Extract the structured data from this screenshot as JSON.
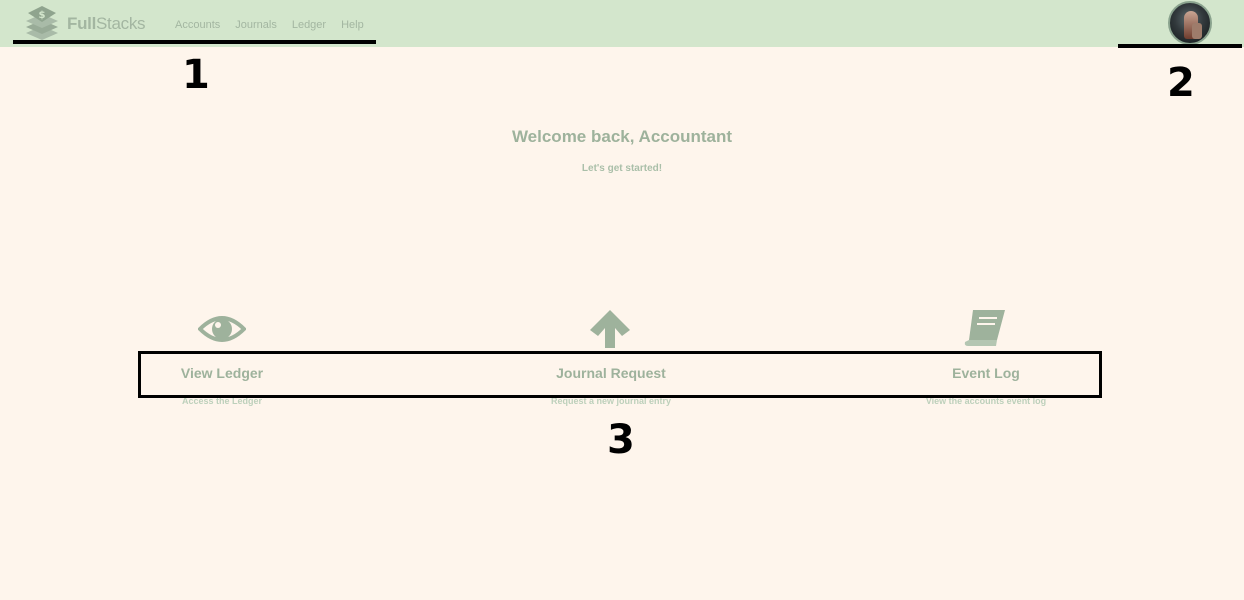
{
  "brand": {
    "name_bold": "Full",
    "name_rest": "Stacks"
  },
  "nav": {
    "items": [
      {
        "label": "Accounts"
      },
      {
        "label": "Journals"
      },
      {
        "label": "Ledger"
      },
      {
        "label": "Help"
      }
    ]
  },
  "welcome": {
    "title": "Welcome back, Accountant",
    "subtitle": "Let's get started!"
  },
  "cards": [
    {
      "title": "View Ledger",
      "desc": "Access the Ledger",
      "icon": "eye-icon"
    },
    {
      "title": "Journal Request",
      "desc": "Request a new journal entry",
      "icon": "arrow-up-icon"
    },
    {
      "title": "Event Log",
      "desc": "View the accounts event log",
      "icon": "book-icon"
    }
  ],
  "callouts": {
    "one": "1",
    "two": "2",
    "three": "3"
  },
  "colors": {
    "navbar": "#d3e6cc",
    "background": "#fef5ec",
    "accent": "#9eb29c"
  }
}
